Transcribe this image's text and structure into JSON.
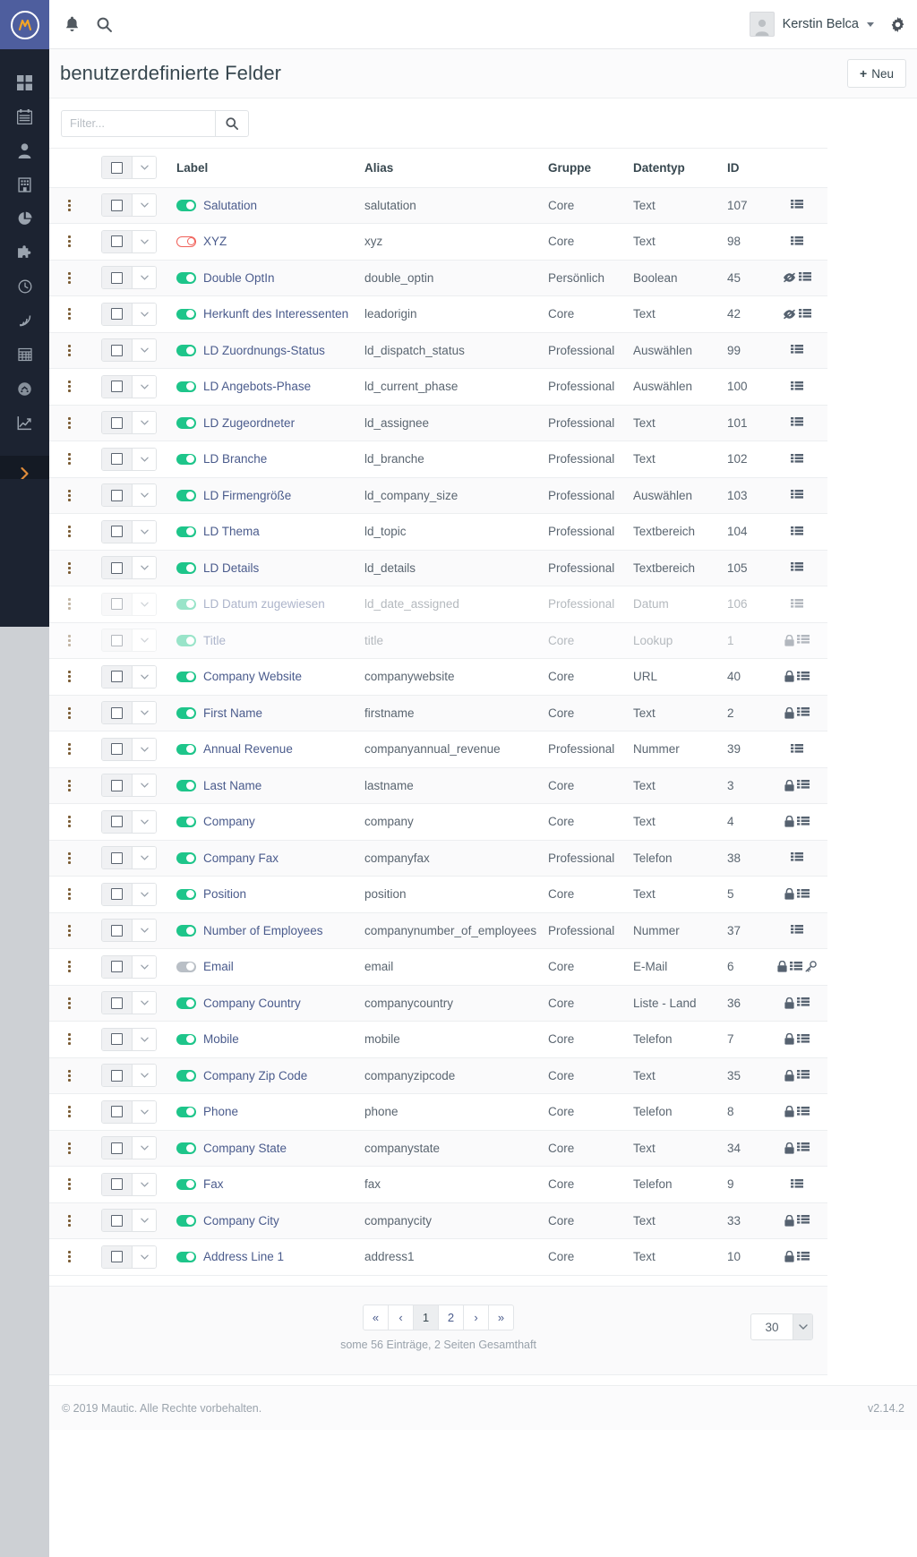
{
  "app": {
    "brand_letter": "M",
    "footer_copyright": "© 2019 Mautic. Alle Rechte vorbehalten.",
    "version": "v2.14.2"
  },
  "topbar": {
    "notifications_icon": "bell-icon",
    "search_icon": "search-icon",
    "username": "Kerstin Belca",
    "settings_icon": "gear-icon",
    "avatar": "avatar"
  },
  "sidebar": {
    "items": [
      {
        "name": "dashboard",
        "icon": "grid-icon"
      },
      {
        "name": "calendar",
        "icon": "calendar-icon"
      },
      {
        "name": "contacts",
        "icon": "user-icon"
      },
      {
        "name": "companies",
        "icon": "building-icon"
      },
      {
        "name": "segments",
        "icon": "pie-chart-icon"
      },
      {
        "name": "campaigns",
        "icon": "puzzle-icon"
      },
      {
        "name": "points",
        "icon": "clock-icon"
      },
      {
        "name": "channels",
        "icon": "rss-icon"
      },
      {
        "name": "forms",
        "icon": "table-icon"
      },
      {
        "name": "reports",
        "icon": "dashboard-gauge-icon"
      },
      {
        "name": "stats",
        "icon": "line-chart-icon"
      }
    ],
    "expander_icon": "chevron-right-icon"
  },
  "page": {
    "title": "benutzerdefinierte Felder",
    "new_button": "Neu",
    "new_button_icon": "plus-icon"
  },
  "filter": {
    "placeholder": "Filter...",
    "value": "",
    "search_icon": "search-icon"
  },
  "table": {
    "columns": [
      "",
      "",
      "Label",
      "Alias",
      "Gruppe",
      "Datentyp",
      "ID",
      ""
    ],
    "headers": {
      "label": "Label",
      "alias": "Alias",
      "gruppe": "Gruppe",
      "datentyp": "Datentyp",
      "id": "ID"
    },
    "rows": [
      {
        "label": "Salutation",
        "alias": "salutation",
        "gruppe": "Core",
        "datentyp": "Text",
        "id": "107",
        "toggle": "on",
        "actions": [
          "list-icon"
        ],
        "faded": false
      },
      {
        "label": "XYZ",
        "alias": "xyz",
        "gruppe": "Core",
        "datentyp": "Text",
        "id": "98",
        "toggle": "off",
        "actions": [
          "list-icon"
        ],
        "faded": false
      },
      {
        "label": "Double OptIn",
        "alias": "double_optin",
        "gruppe": "Persönlich",
        "datentyp": "Boolean",
        "id": "45",
        "toggle": "on",
        "actions": [
          "eye-slash-icon",
          "list-icon"
        ],
        "faded": false
      },
      {
        "label": "Herkunft des Interessenten",
        "alias": "leadorigin",
        "gruppe": "Core",
        "datentyp": "Text",
        "id": "42",
        "toggle": "on",
        "actions": [
          "eye-slash-icon",
          "list-icon"
        ],
        "faded": false
      },
      {
        "label": "LD Zuordnungs-Status",
        "alias": "ld_dispatch_status",
        "gruppe": "Professional",
        "datentyp": "Auswählen",
        "id": "99",
        "toggle": "on",
        "actions": [
          "list-icon"
        ],
        "faded": false
      },
      {
        "label": "LD Angebots-Phase",
        "alias": "ld_current_phase",
        "gruppe": "Professional",
        "datentyp": "Auswählen",
        "id": "100",
        "toggle": "on",
        "actions": [
          "list-icon"
        ],
        "faded": false
      },
      {
        "label": "LD Zugeordneter",
        "alias": "ld_assignee",
        "gruppe": "Professional",
        "datentyp": "Text",
        "id": "101",
        "toggle": "on",
        "actions": [
          "list-icon"
        ],
        "faded": false
      },
      {
        "label": "LD Branche",
        "alias": "ld_branche",
        "gruppe": "Professional",
        "datentyp": "Text",
        "id": "102",
        "toggle": "on",
        "actions": [
          "list-icon"
        ],
        "faded": false
      },
      {
        "label": "LD Firmengröße",
        "alias": "ld_company_size",
        "gruppe": "Professional",
        "datentyp": "Auswählen",
        "id": "103",
        "toggle": "on",
        "actions": [
          "list-icon"
        ],
        "faded": false
      },
      {
        "label": "LD Thema",
        "alias": "ld_topic",
        "gruppe": "Professional",
        "datentyp": "Textbereich",
        "id": "104",
        "toggle": "on",
        "actions": [
          "list-icon"
        ],
        "faded": false
      },
      {
        "label": "LD Details",
        "alias": "ld_details",
        "gruppe": "Professional",
        "datentyp": "Textbereich",
        "id": "105",
        "toggle": "on",
        "actions": [
          "list-icon"
        ],
        "faded": false
      },
      {
        "label": "LD Datum zugewiesen",
        "alias": "ld_date_assigned",
        "gruppe": "Professional",
        "datentyp": "Datum",
        "id": "106",
        "toggle": "on",
        "actions": [
          "list-icon"
        ],
        "faded": true
      },
      {
        "label": "Title",
        "alias": "title",
        "gruppe": "Core",
        "datentyp": "Lookup",
        "id": "1",
        "toggle": "on",
        "actions": [
          "lock-icon",
          "list-icon"
        ],
        "faded": true
      },
      {
        "label": "Company Website",
        "alias": "companywebsite",
        "gruppe": "Core",
        "datentyp": "URL",
        "id": "40",
        "toggle": "on",
        "actions": [
          "lock-icon",
          "list-icon"
        ],
        "faded": false
      },
      {
        "label": "First Name",
        "alias": "firstname",
        "gruppe": "Core",
        "datentyp": "Text",
        "id": "2",
        "toggle": "on",
        "actions": [
          "lock-icon",
          "list-icon"
        ],
        "faded": false
      },
      {
        "label": "Annual Revenue",
        "alias": "companyannual_revenue",
        "gruppe": "Professional",
        "datentyp": "Nummer",
        "id": "39",
        "toggle": "on",
        "actions": [
          "list-icon"
        ],
        "faded": false
      },
      {
        "label": "Last Name",
        "alias": "lastname",
        "gruppe": "Core",
        "datentyp": "Text",
        "id": "3",
        "toggle": "on",
        "actions": [
          "lock-icon",
          "list-icon"
        ],
        "faded": false
      },
      {
        "label": "Company",
        "alias": "company",
        "gruppe": "Core",
        "datentyp": "Text",
        "id": "4",
        "toggle": "on",
        "actions": [
          "lock-icon",
          "list-icon"
        ],
        "faded": false
      },
      {
        "label": "Company Fax",
        "alias": "companyfax",
        "gruppe": "Professional",
        "datentyp": "Telefon",
        "id": "38",
        "toggle": "on",
        "actions": [
          "list-icon"
        ],
        "faded": false
      },
      {
        "label": "Position",
        "alias": "position",
        "gruppe": "Core",
        "datentyp": "Text",
        "id": "5",
        "toggle": "on",
        "actions": [
          "lock-icon",
          "list-icon"
        ],
        "faded": false
      },
      {
        "label": "Number of Employees",
        "alias": "companynumber_of_employees",
        "gruppe": "Professional",
        "datentyp": "Nummer",
        "id": "37",
        "toggle": "on",
        "actions": [
          "list-icon"
        ],
        "faded": false
      },
      {
        "label": "Email",
        "alias": "email",
        "gruppe": "Core",
        "datentyp": "E-Mail",
        "id": "6",
        "toggle": "gray",
        "actions": [
          "lock-icon",
          "list-icon",
          "key-icon"
        ],
        "faded": false
      },
      {
        "label": "Company Country",
        "alias": "companycountry",
        "gruppe": "Core",
        "datentyp": "Liste - Land",
        "id": "36",
        "toggle": "on",
        "actions": [
          "lock-icon",
          "list-icon"
        ],
        "faded": false
      },
      {
        "label": "Mobile",
        "alias": "mobile",
        "gruppe": "Core",
        "datentyp": "Telefon",
        "id": "7",
        "toggle": "on",
        "actions": [
          "lock-icon",
          "list-icon"
        ],
        "faded": false
      },
      {
        "label": "Company Zip Code",
        "alias": "companyzipcode",
        "gruppe": "Core",
        "datentyp": "Text",
        "id": "35",
        "toggle": "on",
        "actions": [
          "lock-icon",
          "list-icon"
        ],
        "faded": false
      },
      {
        "label": "Phone",
        "alias": "phone",
        "gruppe": "Core",
        "datentyp": "Telefon",
        "id": "8",
        "toggle": "on",
        "actions": [
          "lock-icon",
          "list-icon"
        ],
        "faded": false
      },
      {
        "label": "Company State",
        "alias": "companystate",
        "gruppe": "Core",
        "datentyp": "Text",
        "id": "34",
        "toggle": "on",
        "actions": [
          "lock-icon",
          "list-icon"
        ],
        "faded": false
      },
      {
        "label": "Fax",
        "alias": "fax",
        "gruppe": "Core",
        "datentyp": "Telefon",
        "id": "9",
        "toggle": "on",
        "actions": [
          "list-icon"
        ],
        "faded": false
      },
      {
        "label": "Company City",
        "alias": "companycity",
        "gruppe": "Core",
        "datentyp": "Text",
        "id": "33",
        "toggle": "on",
        "actions": [
          "lock-icon",
          "list-icon"
        ],
        "faded": false
      },
      {
        "label": "Address Line 1",
        "alias": "address1",
        "gruppe": "Core",
        "datentyp": "Text",
        "id": "10",
        "toggle": "on",
        "actions": [
          "lock-icon",
          "list-icon"
        ],
        "faded": false
      }
    ]
  },
  "pagination": {
    "first": "«",
    "prev": "‹",
    "pages": [
      "1",
      "2"
    ],
    "active_page": "1",
    "next": "›",
    "last": "»",
    "summary": "some 56 Einträge, 2 Seiten Gesamthaft",
    "page_size": "30"
  },
  "colors": {
    "brand": "#4e5e9e",
    "sidebar": "#1c2331",
    "toggle_on": "#1ec58a",
    "toggle_off": "#f0615a",
    "link": "#4a5b8c",
    "accent_orange": "#e08c3a"
  }
}
